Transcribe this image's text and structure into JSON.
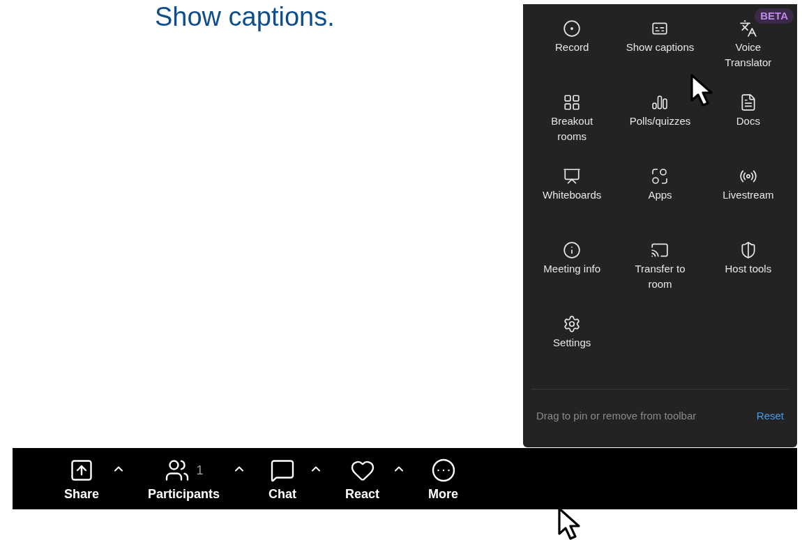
{
  "heading": "Show captions.",
  "more_menu": {
    "items": [
      {
        "label": "Record"
      },
      {
        "label": "Show captions"
      },
      {
        "label": "Voice Translator",
        "badge": "BETA"
      },
      {
        "label": "Breakout rooms"
      },
      {
        "label": "Polls/quizzes"
      },
      {
        "label": "Docs"
      },
      {
        "label": "Whiteboards"
      },
      {
        "label": "Apps"
      },
      {
        "label": "Livestream"
      },
      {
        "label": "Meeting info"
      },
      {
        "label": "Transfer to room"
      },
      {
        "label": "Host tools"
      },
      {
        "label": "Settings"
      }
    ],
    "hint": "Drag to pin or remove from toolbar",
    "reset": "Reset"
  },
  "toolbar": [
    {
      "label": "Share",
      "has_menu": true
    },
    {
      "label": "Participants",
      "count": "1",
      "has_menu": true
    },
    {
      "label": "Chat",
      "has_menu": true
    },
    {
      "label": "React",
      "has_menu": true
    },
    {
      "label": "More",
      "has_menu": false
    }
  ]
}
